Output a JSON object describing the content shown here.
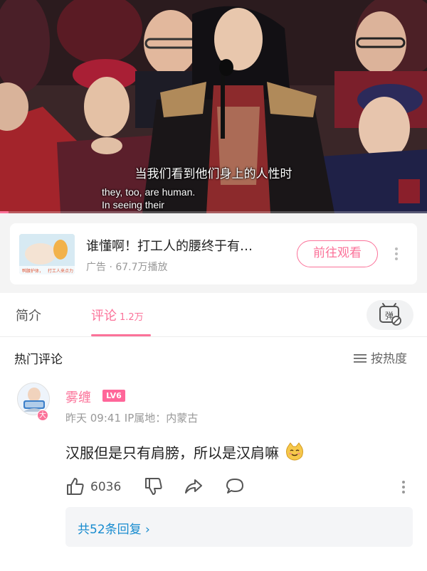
{
  "video": {
    "subtitle_cn": "当我们看到他们身上的人性时",
    "subtitle_en_1": "they, too, are human.",
    "subtitle_en_2": "In seeing their",
    "progress": 0.02
  },
  "ad": {
    "title": "谁懂啊！打工人的腰终于有…",
    "meta": "广告 · 67.7万播放",
    "button": "前往观看",
    "thumb_caption_left": "鸭腰护体，",
    "thumb_caption_right": "打工人来点力"
  },
  "tabs": {
    "intro": "简介",
    "comments": "评论",
    "comments_count": "1.2万",
    "danmaku_icon": "弹"
  },
  "section": {
    "title": "热门评论",
    "sort_label": "按热度"
  },
  "comment": {
    "username": "雾缠",
    "level": "LV6",
    "avatar_badge": "大",
    "meta": "昨天 09:41 IP属地：内蒙古",
    "content": "汉服但是只有肩膀，所以是汉肩嘛",
    "likes": "6036",
    "replies_label": "共52条回复 ›"
  },
  "colors": {
    "accent": "#fb7299",
    "link": "#178bcf"
  }
}
